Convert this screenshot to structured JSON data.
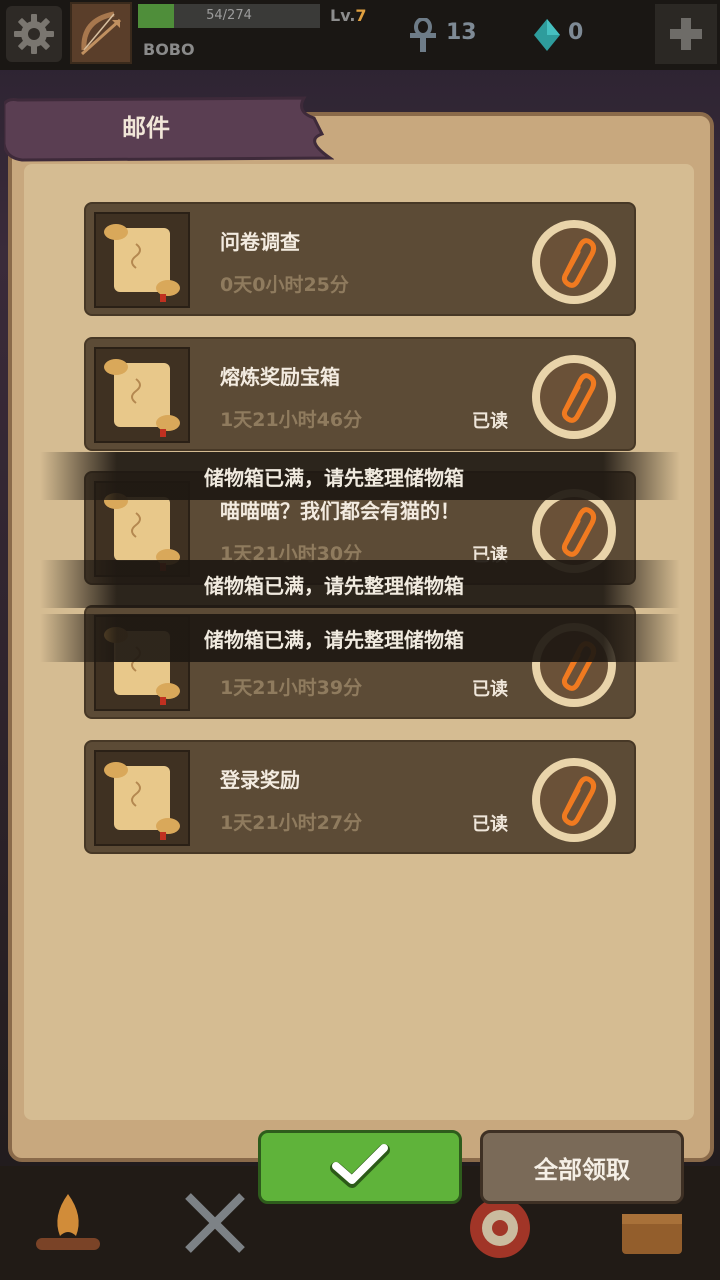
{
  "player": {
    "name": "BOBO",
    "xp_text": "54/274",
    "xp_fraction": 0.197,
    "level_label": "Lv.",
    "level_value": "7",
    "ankh_count": "13",
    "gem_count": "0"
  },
  "panel": {
    "title": "邮件"
  },
  "mails": [
    {
      "title": "问卷调查",
      "time": "0天0小时25分",
      "read": ""
    },
    {
      "title": "熔炼奖励宝箱",
      "time": "1天21小时46分",
      "read": "已读"
    },
    {
      "title": "喵喵喵？我们都会有猫的！",
      "time": "1天21小时30分",
      "read": "已读"
    },
    {
      "title": "",
      "time": "1天21小时39分",
      "read": "已读"
    },
    {
      "title": "登录奖励",
      "time": "1天21小时27分",
      "read": "已读"
    }
  ],
  "toasts": [
    "储物箱已满，请先整理储物箱",
    "储物箱已满，请先整理储物箱",
    "储物箱已满，请先整理储物箱"
  ],
  "buttons": {
    "claim_all": "全部领取"
  },
  "colors": {
    "accent_green": "#5fb33a",
    "panel": "#c8a87e",
    "item_bg": "#5c4b36"
  }
}
